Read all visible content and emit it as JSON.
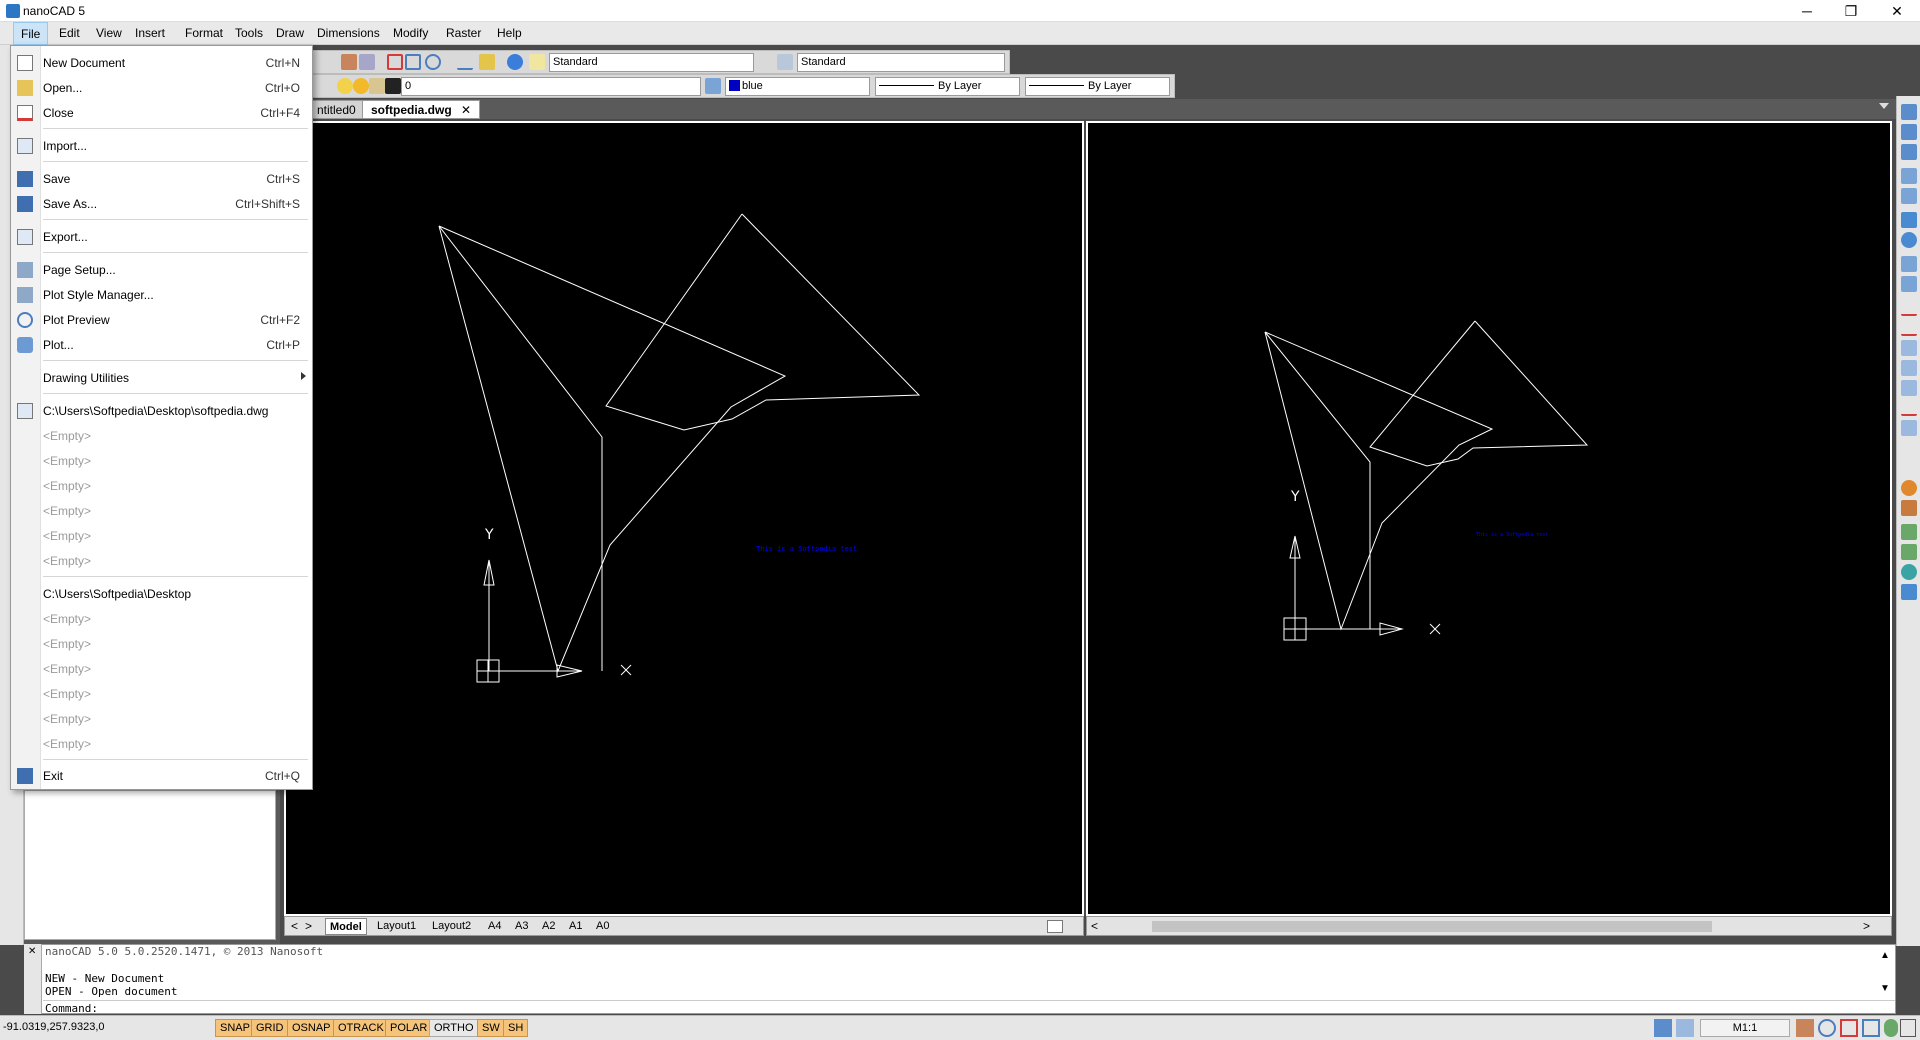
{
  "window": {
    "title": "nanoCAD 5",
    "minimize": "─",
    "restore": "❐",
    "close": "✕"
  },
  "menubar": [
    "File",
    "Edit",
    "View",
    "Insert",
    "Format",
    "Tools",
    "Draw",
    "Dimensions",
    "Modify",
    "Raster",
    "Help"
  ],
  "toolbar": {
    "textstyle": "Standard",
    "dimstyle": "Standard",
    "layer": "0",
    "color": "blue",
    "linetype": "By Layer",
    "lineweight": "By Layer"
  },
  "doc_tabs": [
    "ntitled0",
    "softpedia.dwg"
  ],
  "doc_tab_close": "✕",
  "file_menu": {
    "group1": [
      {
        "label": "New Document",
        "shortcut": "Ctrl+N"
      },
      {
        "label": "Open...",
        "shortcut": "Ctrl+O"
      },
      {
        "label": "Close",
        "shortcut": "Ctrl+F4"
      }
    ],
    "group2": [
      {
        "label": "Import...",
        "shortcut": ""
      }
    ],
    "group3": [
      {
        "label": "Save",
        "shortcut": "Ctrl+S"
      },
      {
        "label": "Save As...",
        "shortcut": "Ctrl+Shift+S"
      }
    ],
    "group4": [
      {
        "label": "Export...",
        "shortcut": ""
      }
    ],
    "group5": [
      {
        "label": "Page Setup...",
        "shortcut": ""
      },
      {
        "label": "Plot Style Manager...",
        "shortcut": ""
      },
      {
        "label": "Plot Preview",
        "shortcut": "Ctrl+F2"
      },
      {
        "label": "Plot...",
        "shortcut": "Ctrl+P"
      }
    ],
    "group6": [
      {
        "label": "Drawing Utilities",
        "shortcut": ""
      }
    ],
    "recent_files": [
      "C:\\Users\\Softpedia\\Desktop\\softpedia.dwg",
      "<Empty>",
      "<Empty>",
      "<Empty>",
      "<Empty>",
      "<Empty>",
      "<Empty>"
    ],
    "recent_folders": [
      "C:\\Users\\Softpedia\\Desktop",
      "<Empty>",
      "<Empty>",
      "<Empty>",
      "<Empty>",
      "<Empty>",
      "<Empty>"
    ],
    "exit": {
      "label": "Exit",
      "shortcut": "Ctrl+Q"
    }
  },
  "viewport": {
    "axis_y": "Y",
    "axis_x": "X",
    "text_left": "This is a Softpedia test",
    "text_right": "This is a Softpedia test"
  },
  "layout_tabs": [
    "Model",
    "Layout1",
    "Layout2",
    "A4",
    "A3",
    "A2",
    "A1",
    "A0"
  ],
  "command": {
    "line1": "nanoCAD 5.0 5.0.2520.1471, © 2013 Nanosoft",
    "line2": "NEW - New Document",
    "line3": "OPEN - Open document",
    "prompt": "Command:"
  },
  "status": {
    "coords": "-91.0319,257.9323,0",
    "buttons": [
      "SNAP",
      "GRID",
      "OSNAP",
      "OTRACK",
      "POLAR",
      "ORTHO",
      "SW",
      "SH"
    ],
    "scale": "M1:1"
  }
}
